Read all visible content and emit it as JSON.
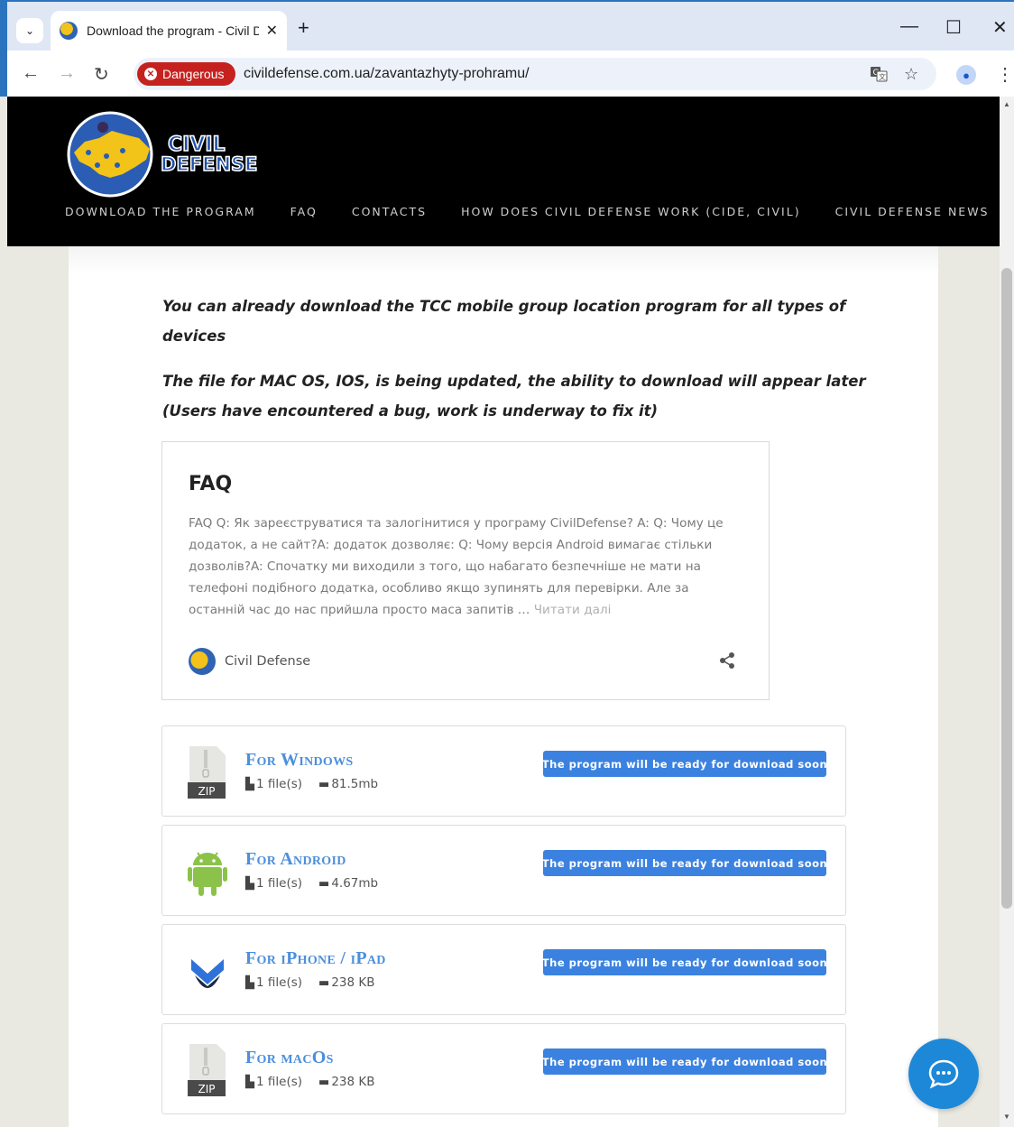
{
  "browser": {
    "tab_title": "Download the program - Civil D",
    "tab_close": "✕",
    "new_tab": "+",
    "security_label": "Dangerous",
    "url": "civildefense.com.ua/zavantazhyty-prohramu/",
    "window_controls": [
      "—",
      "☐",
      "✕"
    ]
  },
  "site": {
    "logo_text_1": "CIVIL",
    "logo_text_2": "DEFENSE",
    "nav": [
      "DOWNLOAD THE PROGRAM",
      "FAQ",
      "CONTACTS",
      "HOW DOES CIVIL DEFENSE WORK (CIDE, CIVIL)",
      "CIVIL DEFENSE NEWS"
    ]
  },
  "content": {
    "lead_1": "You can already download the TCC mobile group location program for all types of devices",
    "dot": ".",
    "lead_2": "The file for MAC OS, IOS, is being updated, the ability to download will appear later (Users have encountered a bug, work is underway to fix it)",
    "faq": {
      "title": "FAQ",
      "excerpt": "FAQ Q: Як зареєструватися та залогінитися у програму CivilDefense? A: Q: Чому це додаток, а не сайт?A: додаток дозволяє: Q: Чому версія Android вимагає стільки дозволів?A: Спочатку ми виходили з того, що набагато безпечніше не мати на телефоні подібного додатка, особливо якщо зупинять для перевірки. Але за останній час до нас прийшла просто маса запитів …",
      "read_more": "Читати далі",
      "author": "Civil Defense"
    },
    "downloads": [
      {
        "name": "For Windows",
        "files": "1 file(s)",
        "size": "81.5mb",
        "button": "The program will be ready for download soon",
        "icon": "zip-file-icon",
        "icon_label": "ZIP"
      },
      {
        "name": "For Android",
        "files": "1 file(s)",
        "size": "4.67mb",
        "button": "The program will be ready for download soon",
        "icon": "android-icon",
        "icon_label": ""
      },
      {
        "name": "For iPhone / iPad",
        "files": "1 file(s)",
        "size": "238 KB",
        "button": "The program will be ready for download soon",
        "icon": "chevron-down-icon",
        "icon_label": ""
      },
      {
        "name": "For macOs",
        "files": "1 file(s)",
        "size": "238 KB",
        "button": "The program will be ready for download soon",
        "icon": "zip-file-icon",
        "icon_label": "ZIP"
      }
    ]
  },
  "colors": {
    "accent_blue": "#3b82e0",
    "link_blue": "#4c8fdc",
    "danger_red": "#c5221f",
    "chat_blue": "#1e88d8"
  }
}
